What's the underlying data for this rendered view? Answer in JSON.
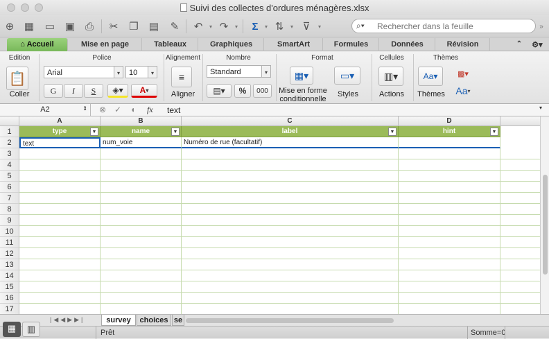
{
  "window": {
    "title": "Suivi des collectes d'ordures ménagères.xlsx"
  },
  "search": {
    "placeholder": "Rechercher dans la feuille"
  },
  "ribbon_tabs": [
    {
      "label": "Accueil"
    },
    {
      "label": "Mise en page"
    },
    {
      "label": "Tableaux"
    },
    {
      "label": "Graphiques"
    },
    {
      "label": "SmartArt"
    },
    {
      "label": "Formules"
    },
    {
      "label": "Données"
    },
    {
      "label": "Révision"
    }
  ],
  "ribbon": {
    "groups": {
      "edition": "Edition",
      "police": "Police",
      "alignement": "Alignement",
      "nombre": "Nombre",
      "format": "Format",
      "cellules": "Cellules",
      "themes": "Thèmes"
    },
    "coller_label": "Coller",
    "font_name": "Arial",
    "font_size": "10",
    "bold": "G",
    "italic": "I",
    "underline": "S",
    "font_color_glyph": "A",
    "aligner_label": "Aligner",
    "number_format": "Standard",
    "percent": "%",
    "thousands": "000",
    "mise_en_forme_line1": "Mise en forme",
    "mise_en_forme_line2": "conditionnelle",
    "styles_label": "Styles",
    "actions_label": "Actions",
    "themes_label": "Thèmes",
    "fonts_glyph": "Aa"
  },
  "formula_bar": {
    "cell_ref": "A2",
    "fx": "fx",
    "value": "text"
  },
  "columns": [
    "A",
    "B",
    "C",
    "D"
  ],
  "header_row": [
    "type",
    "name",
    "label",
    "hint"
  ],
  "data_rows": [
    [
      "text",
      "num_voie",
      "Numéro de rue (facultatif)",
      ""
    ]
  ],
  "row_numbers": [
    "1",
    "2",
    "3",
    "4",
    "5",
    "6",
    "7",
    "8",
    "9",
    "10",
    "11",
    "12",
    "13",
    "14",
    "15",
    "16",
    "17"
  ],
  "sheets": [
    {
      "name": "survey",
      "active": true
    },
    {
      "name": "choices",
      "active": false
    },
    {
      "name": "se",
      "active": false
    }
  ],
  "status": {
    "ready": "Prêt",
    "sum": "Somme=0"
  },
  "colors": {
    "accent": "#9bbb59",
    "tab_active": "#78b85a"
  }
}
